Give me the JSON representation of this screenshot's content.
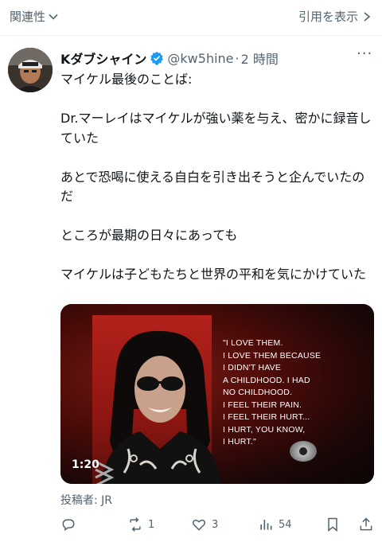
{
  "topbar": {
    "relevance_label": "関連性",
    "quotes_label": "引用を表示"
  },
  "tweet": {
    "author_name": "Kダブシャイン",
    "handle": "@kw5hine",
    "separator": "·",
    "time": "2 時間",
    "text": "マイケル最後のことば:\n\nDr.マーレイはマイケルが強い薬を与え、密かに録音していた\n\nあとで恐喝に使える自白を引き出そうと企んでいたのだ\n\nところが最期の日々にあっても\n\nマイケルは子どもたちと世界の平和を気にかけていた",
    "media": {
      "quote": "\"I LOVE THEM.\nI LOVE THEM BECAUSE\nI DIDN'T HAVE\nA CHILDHOOD. I HAD\nNO CHILDHOOD.\nI FEEL THEIR PAIN.\nI FEEL THEIR HURT...\nI HURT, YOU KNOW,\nI HURT.\"",
      "duration": "1:20"
    },
    "attribution": "投稿者: JR"
  },
  "actions": {
    "retweets": "1",
    "likes": "3",
    "views": "54"
  },
  "colors": {
    "secondary_text": "#536471",
    "verified_blue": "#1d9bf0",
    "divider": "#eff3f4"
  }
}
